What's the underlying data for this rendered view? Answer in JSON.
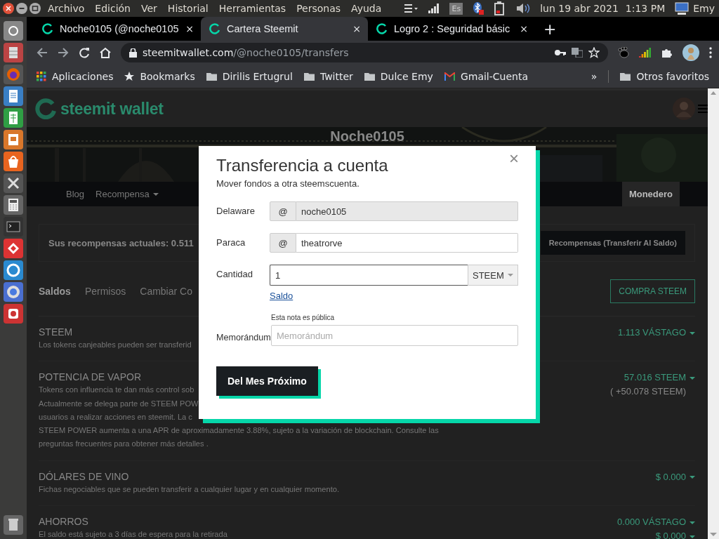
{
  "top_panel": {
    "menus": [
      "Archivo",
      "Edición",
      "Ver",
      "Historial",
      "Herramientas",
      "Personas",
      "Ayuda"
    ],
    "keyboard_layout": "Es",
    "date": "lun 19 abr 2021",
    "time": "1:13 PM",
    "user": "Emy"
  },
  "browser": {
    "tabs": [
      {
        "title": "Noche0105 (@noche0105",
        "selected": false,
        "close": "×"
      },
      {
        "title": "Cartera Steemit",
        "selected": true,
        "close": "×"
      },
      {
        "title": "Logro 2 : Seguridad básic",
        "selected": false,
        "close": "×"
      }
    ],
    "new_tab": "+",
    "url": {
      "host": "steemitwallet.com",
      "path": "/@noche0105/transfers"
    },
    "bookmarks": [
      {
        "label": "Aplicaciones",
        "kind": "apps"
      },
      {
        "label": "Bookmarks",
        "kind": "star"
      },
      {
        "label": "Dirilis Ertugrul",
        "kind": "folder"
      },
      {
        "label": "Twitter",
        "kind": "folder"
      },
      {
        "label": "Dulce Emy",
        "kind": "folder"
      },
      {
        "label": "Gmail-Cuenta",
        "kind": "gmail"
      }
    ],
    "overflow": "»",
    "other_bookmarks": "Otros favoritos"
  },
  "page": {
    "logo_text": "steemit wallet",
    "profile_name": "Noche0105",
    "nav": [
      {
        "label": "Blog",
        "selected": false,
        "dropdown": false
      },
      {
        "label": "Recompensa",
        "selected": false,
        "dropdown": true
      },
      {
        "label": "Monedero",
        "selected": true,
        "dropdown": false
      }
    ],
    "rewards": {
      "text": "Sus recompensas actuales: 0.511",
      "button": "Recompensas (Transferir Al Saldo)"
    },
    "wallet_tabs": [
      {
        "label": "Saldos",
        "selected": true
      },
      {
        "label": "Permisos",
        "selected": false
      },
      {
        "label": "Cambiar Co",
        "selected": false
      }
    ],
    "buy_button": "COMPRA STEEM",
    "balances": [
      {
        "title": "STEEM",
        "description_lines": [
          "Los tokens canjeables pueden ser transferid"
        ],
        "values": [
          {
            "text": "1.113 VÁSTAGO",
            "dropdown": true
          }
        ]
      },
      {
        "title": "POTENCIA DE VAPOR",
        "description_lines": [
          "Tokens con influencia te dan más control sob",
          "Actualmente se delega parte de STEEM POW",
          "usuarios a realizar acciones en steemit. La c",
          "STEEM POWER aumenta a una APR de aproximadamente 3.88%, sujeto a la variación de blockchain. Consulte las",
          "preguntas frecuentes para obtener más detalles ."
        ],
        "values": [
          {
            "text": "57.016 STEEM",
            "dropdown": true
          },
          {
            "text": "( +50.078 STEEM)",
            "dropdown": false
          }
        ]
      },
      {
        "title": "DÓLARES DE VINO",
        "description_lines": [
          "Fichas negociables que se pueden transferir a cualquier lugar y en cualquier momento."
        ],
        "values": [
          {
            "text": "$ 0.000",
            "dropdown": true
          }
        ]
      },
      {
        "title": "AHORROS",
        "description_lines": [
          "El saldo está sujeto a 3 días de espera para la retirada"
        ],
        "values": [
          {
            "text": "0.000 VÁSTAGO",
            "dropdown": true
          },
          {
            "text": "$ 0.000",
            "dropdown": true
          }
        ]
      }
    ]
  },
  "dialog": {
    "title": "Transferencia a cuenta",
    "subtitle": "Mover fondos a otra steemscuenta.",
    "close": "×",
    "fields": [
      {
        "kind": "account",
        "label": "Delaware",
        "prefix": "@",
        "value": "noche0105",
        "disabled": true
      },
      {
        "kind": "account",
        "label": "Paraca",
        "prefix": "@",
        "value": "theatrorve",
        "disabled": false
      },
      {
        "kind": "amount",
        "label": "Cantidad",
        "value": "1",
        "unit": "STEEM",
        "link": "Saldo",
        "disabled": false
      },
      {
        "kind": "memo",
        "label": "Memorándum",
        "note": "Esta nota es pública",
        "placeholder": "Memorándum",
        "disabled": false
      }
    ],
    "submit": "Del Mes Próximo"
  }
}
